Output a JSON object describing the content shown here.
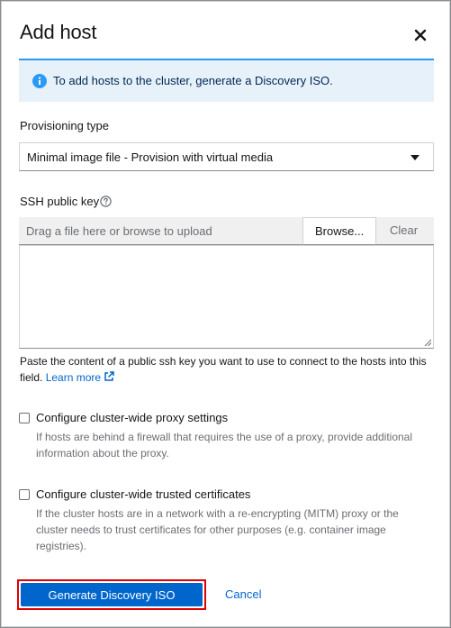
{
  "modal": {
    "title": "Add host"
  },
  "alert": {
    "text": "To add hosts to the cluster, generate a Discovery ISO."
  },
  "provisioning": {
    "label": "Provisioning type",
    "selected": "Minimal image file - Provision with virtual media"
  },
  "ssh": {
    "label": "SSH public key",
    "placeholder": "Drag a file here or browse to upload",
    "browse": "Browse...",
    "clear": "Clear",
    "value": "",
    "helper": "Paste the content of a public ssh key you want to use to connect to the hosts into this field.",
    "learn_more": "Learn more"
  },
  "proxy": {
    "label": "Configure cluster-wide proxy settings",
    "description": "If hosts are behind a firewall that requires the use of a proxy, provide additional information about the proxy."
  },
  "certificates": {
    "label": "Configure cluster-wide trusted certificates",
    "description": "If the cluster hosts are in a network with a re-encrypting (MITM) proxy or the cluster needs to trust certificates for other purposes (e.g. container image registries)."
  },
  "footer": {
    "primary": "Generate Discovery ISO",
    "cancel": "Cancel"
  },
  "icons": {
    "close": "close-icon",
    "info": "info-circle-icon",
    "help": "help-circle-icon",
    "caret": "caret-down-icon",
    "external": "external-link-icon"
  },
  "colors": {
    "primary": "#0066cc",
    "info_bg": "#e7f1fa",
    "info_accent": "#2b9af3",
    "highlight": "#e00000"
  }
}
